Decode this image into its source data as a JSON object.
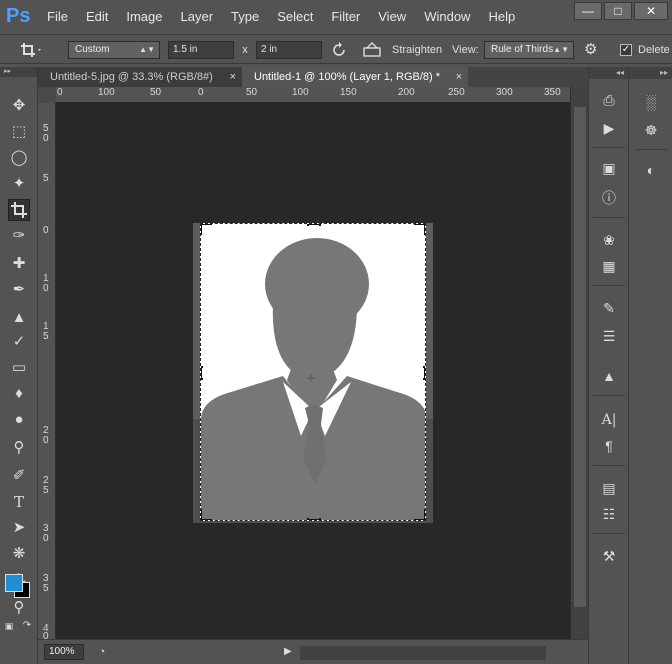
{
  "app": {
    "logo": "Ps"
  },
  "menu": [
    "File",
    "Edit",
    "Image",
    "Layer",
    "Type",
    "Select",
    "Filter",
    "View",
    "Window",
    "Help"
  ],
  "window_controls": {
    "minimize": "—",
    "maximize": "□",
    "close": "✕"
  },
  "options": {
    "preset": "Custom",
    "width": "1.5 in",
    "times": "x",
    "height": "2 in",
    "straighten_label": "Straighten",
    "view_label": "View:",
    "view_value": "Rule of Thirds",
    "delete_label": "Delete"
  },
  "tabs": [
    {
      "label": "Untitled-5.jpg @ 33.3% (RGB/8#)",
      "active": false
    },
    {
      "label": "Untitled-1 @ 100% (Layer 1, RGB/8) *",
      "active": true
    }
  ],
  "tab_close": "×",
  "ruler_top": [
    "0",
    "100",
    "50",
    "0",
    "50",
    "100",
    "150",
    "200",
    "250",
    "300",
    "350"
  ],
  "ruler_left": [
    "5",
    "0",
    "5",
    "0",
    "1",
    "0",
    "1",
    "5",
    "2",
    "0",
    "2",
    "5",
    "3",
    "0",
    "3",
    "5",
    "4",
    "0"
  ],
  "status": {
    "zoom": "100%"
  },
  "colors": {
    "foreground": "#1e8fd6",
    "background": "#000000",
    "silhouette": "#777777"
  },
  "icons": {
    "left": [
      "move-icon",
      "marquee-icon",
      "lasso-icon",
      "magic-wand-icon",
      "crop-icon",
      "eyedropper-icon",
      "healing-icon",
      "brush-icon",
      "stamp-icon",
      "history-brush-icon",
      "eraser-icon",
      "paint-bucket-icon",
      "blur-icon",
      "dodge-icon",
      "pen-icon",
      "type-icon",
      "path-select-icon",
      "shape-icon",
      "hand-icon",
      "zoom-icon"
    ]
  }
}
